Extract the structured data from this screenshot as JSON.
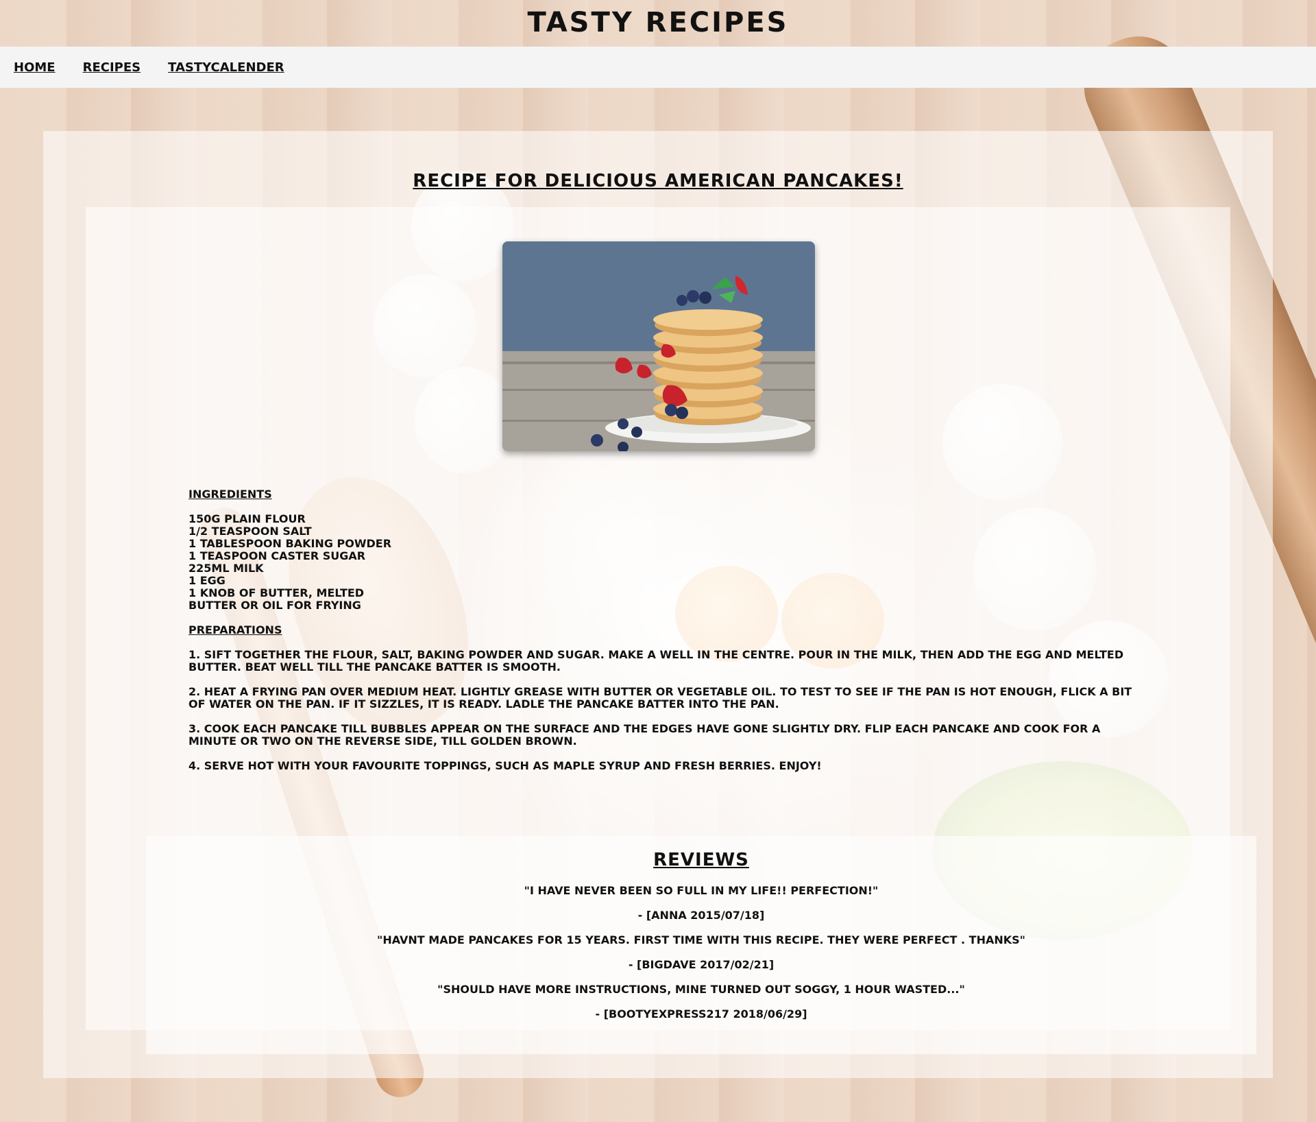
{
  "site": {
    "title": "Tasty Recipes"
  },
  "nav": {
    "items": [
      {
        "label": "Home"
      },
      {
        "label": "Recipes"
      },
      {
        "label": "TastyCalender"
      }
    ]
  },
  "recipe": {
    "title": "Recipe for delicious American Pancakes!",
    "ingredients_heading": "Ingredients",
    "ingredients": [
      "150g plain flour",
      "1/2 teaspoon salt",
      "1 tablespoon baking powder",
      "1 teaspoon caster sugar",
      "225ml milk",
      "1 egg",
      "1 knob of butter, melted",
      "butter or oil for frying"
    ],
    "preparations_heading": "Preparations",
    "steps": [
      "1. Sift together the flour, salt, baking powder and sugar. Make a well in the centre. Pour in the milk, then add the egg and melted butter. Beat well till the pancake batter is smooth.",
      "2. Heat a frying pan over medium heat. Lightly grease with butter or vegetable oil. To test to see if the pan is hot enough, flick a bit of water on the pan. If it sizzles, it is ready. Ladle the pancake batter into the pan.",
      "3. Cook each pancake till bubbles appear on the surface and the edges have gone slightly dry. Flip each pancake and cook for a minute or two on the reverse side, till golden brown.",
      "4. Serve hot with your favourite toppings, such as maple syrup and fresh berries. Enjoy!"
    ]
  },
  "reviews": {
    "title": "Reviews",
    "items": [
      {
        "quote": "\"I have never been so full in my life!! Perfection!\"",
        "author": "- [Anna 2015/07/18]"
      },
      {
        "quote": "\"Havnt made pancakes for 15 years. First time with this recipe. They were perfect . Thanks\"",
        "author": "- [BigDave 2017/02/21]"
      },
      {
        "quote": "\"Should have more instructions, mine turned out soggy, 1 hour wasted...\"",
        "author": "- [BootyExpress217 2018/06/29]"
      }
    ]
  },
  "colors": {
    "text": "#111111",
    "navbar_bg": "#f4f4f4",
    "panel_overlay": "#ffffff"
  }
}
